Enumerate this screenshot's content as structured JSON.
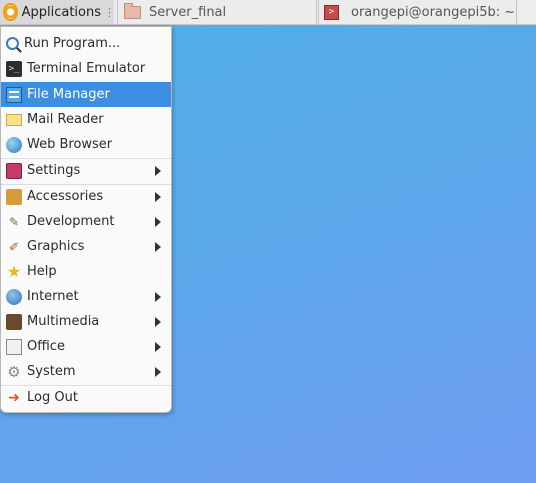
{
  "panel": {
    "apps_label": "Applications",
    "handle": "⋮",
    "tasks": [
      {
        "label": "Server_final"
      },
      {
        "label": "orangepi@orangepi5b: ~"
      }
    ]
  },
  "menu": {
    "items": [
      {
        "label": "Run Program...",
        "icon": "search-icon"
      },
      {
        "label": "Terminal Emulator",
        "icon": "terminal-icon"
      },
      {
        "label": "File Manager",
        "icon": "file-manager-icon",
        "active": true
      },
      {
        "label": "Mail Reader",
        "icon": "mail-icon"
      },
      {
        "label": "Web Browser",
        "icon": "globe-icon"
      },
      {
        "label": "Settings",
        "icon": "settings-icon",
        "submenu": true
      },
      {
        "label": "Accessories",
        "icon": "accessories-icon",
        "submenu": true
      },
      {
        "label": "Development",
        "icon": "development-icon",
        "submenu": true
      },
      {
        "label": "Graphics",
        "icon": "graphics-icon",
        "submenu": true
      },
      {
        "label": "Help",
        "icon": "star-icon"
      },
      {
        "label": "Internet",
        "icon": "internet-icon",
        "submenu": true
      },
      {
        "label": "Multimedia",
        "icon": "multimedia-icon",
        "submenu": true
      },
      {
        "label": "Office",
        "icon": "office-icon",
        "submenu": true
      },
      {
        "label": "System",
        "icon": "gear-icon",
        "submenu": true
      },
      {
        "label": "Log Out",
        "icon": "logout-icon"
      }
    ]
  },
  "colors": {
    "accent": "#3d8ee0",
    "desktop_top": "#4fb0e4",
    "desktop_bottom": "#6f9cf0"
  }
}
